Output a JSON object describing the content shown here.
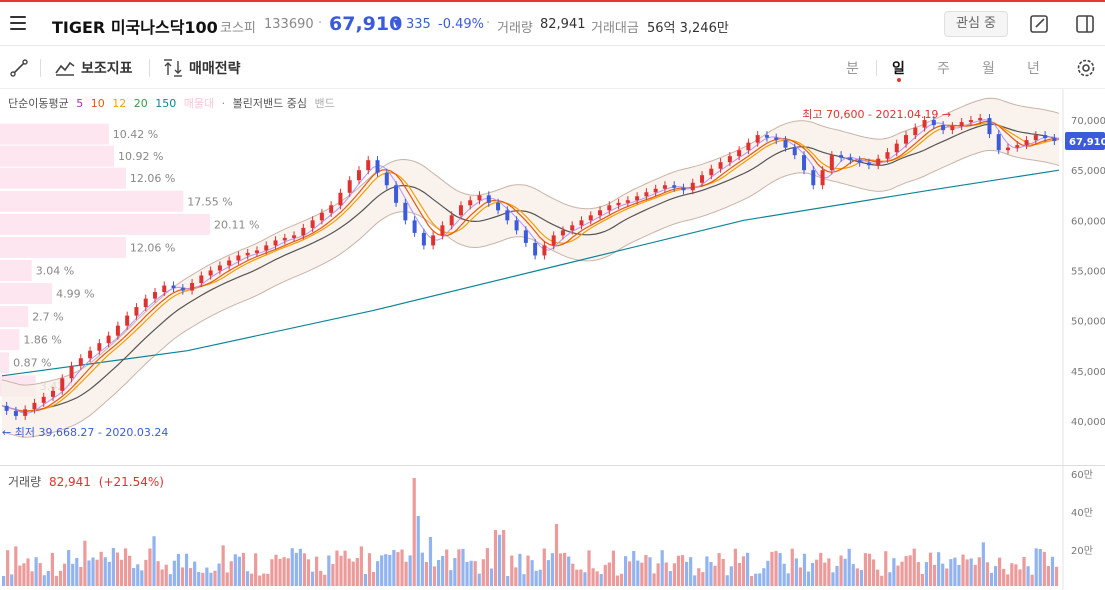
{
  "header": {
    "stock_name": "TIGER 미국나스닥100",
    "market": "코스피",
    "code": "133690",
    "price": "67,910",
    "change_arrow": "▼",
    "change": "335",
    "change_pct": "-0.49%",
    "volume_label": "거래량",
    "volume": "82,941",
    "amount_label": "거래대금",
    "amount": "56억 3,246만",
    "interest_button": "관심 중"
  },
  "toolbar": {
    "indicator_label": "보조지표",
    "strategy_label": "매매전략",
    "periods": [
      "분",
      "일",
      "주",
      "월",
      "년"
    ],
    "active_period": "일"
  },
  "legend": {
    "ma_label": "단순이동평균",
    "ma_periods": [
      {
        "text": "5",
        "color": "#9c36b5"
      },
      {
        "text": "10",
        "color": "#e8590c"
      },
      {
        "text": "12",
        "color": "#f59f00"
      },
      {
        "text": "20",
        "color": "#2f9e44"
      },
      {
        "text": "150",
        "color": "#0c8599"
      }
    ],
    "faded": "매물대",
    "bb_label": "볼린저밴드 중심",
    "band_label": "밴드"
  },
  "annotations": {
    "high": "최고 70,600 - 2021.04.19",
    "low": "최저 39,668.27 - 2020.03.24",
    "current_price_tag": "67,910"
  },
  "colors": {
    "accent_red": "#e03131",
    "accent_blue": "#3b5bdb",
    "volume_profile": "#fde2ef",
    "ma150": "#0c8599"
  },
  "volume_panel": {
    "label": "거래량",
    "value": "82,941",
    "change": "(+21.54%)"
  },
  "chart_data": {
    "type": "line",
    "y_axis_ticks": [
      "70,000",
      "65,000",
      "60,000",
      "55,000",
      "50,000",
      "45,000",
      "40,000"
    ],
    "ylim": [
      36000,
      72500
    ],
    "volume_axis_ticks": [
      "60만",
      "40만",
      "20만"
    ],
    "volume_profile": [
      {
        "label": "10.42 %",
        "price": 68600,
        "pct": 10.42
      },
      {
        "label": "10.92 %",
        "price": 66400,
        "pct": 10.92
      },
      {
        "label": "12.06 %",
        "price": 64200,
        "pct": 12.06
      },
      {
        "label": "17.55 %",
        "price": 61900,
        "pct": 17.55
      },
      {
        "label": "20.11 %",
        "price": 59600,
        "pct": 20.11
      },
      {
        "label": "12.06 %",
        "price": 57300,
        "pct": 12.06
      },
      {
        "label": "3.04 %",
        "price": 55000,
        "pct": 3.04
      },
      {
        "label": "4.99 %",
        "price": 52700,
        "pct": 4.99
      },
      {
        "label": "2.7 %",
        "price": 50400,
        "pct": 2.7
      },
      {
        "label": "1.86 %",
        "price": 48100,
        "pct": 1.86
      },
      {
        "label": "0.87 %",
        "price": 45800,
        "pct": 0.87
      },
      {
        "label": "3.42 %",
        "price": 43500,
        "pct": 3.42
      }
    ],
    "price_path": [
      [
        0,
        41500
      ],
      [
        2,
        40500
      ],
      [
        4,
        41800
      ],
      [
        6,
        43000
      ],
      [
        8,
        45500
      ],
      [
        10,
        47000
      ],
      [
        12,
        48500
      ],
      [
        14,
        50500
      ],
      [
        16,
        52200
      ],
      [
        18,
        53500
      ],
      [
        20,
        53000
      ],
      [
        22,
        54500
      ],
      [
        24,
        55500
      ],
      [
        26,
        56500
      ],
      [
        28,
        57000
      ],
      [
        30,
        58000
      ],
      [
        32,
        58500
      ],
      [
        34,
        60000
      ],
      [
        36,
        61500
      ],
      [
        38,
        64000
      ],
      [
        40,
        66000
      ],
      [
        42,
        63500
      ],
      [
        44,
        60000
      ],
      [
        46,
        57500
      ],
      [
        48,
        59500
      ],
      [
        50,
        61500
      ],
      [
        52,
        62500
      ],
      [
        54,
        61000
      ],
      [
        56,
        59000
      ],
      [
        58,
        56500
      ],
      [
        60,
        58500
      ],
      [
        62,
        59500
      ],
      [
        64,
        60500
      ],
      [
        66,
        61500
      ],
      [
        68,
        62000
      ],
      [
        70,
        62800
      ],
      [
        72,
        63500
      ],
      [
        74,
        63000
      ],
      [
        76,
        64500
      ],
      [
        78,
        65800
      ],
      [
        80,
        67000
      ],
      [
        82,
        68500
      ],
      [
        84,
        68000
      ],
      [
        86,
        66500
      ],
      [
        88,
        63500
      ],
      [
        90,
        66500
      ],
      [
        92,
        66000
      ],
      [
        94,
        65500
      ],
      [
        96,
        66800
      ],
      [
        98,
        68500
      ],
      [
        100,
        70000
      ],
      [
        102,
        69000
      ],
      [
        104,
        69800
      ],
      [
        106,
        70200
      ],
      [
        108,
        67000
      ],
      [
        110,
        67500
      ],
      [
        112,
        68500
      ],
      [
        114,
        67910
      ]
    ],
    "ma150_path": [
      [
        0,
        44500
      ],
      [
        20,
        47000
      ],
      [
        40,
        51000
      ],
      [
        60,
        55500
      ],
      [
        80,
        60000
      ],
      [
        100,
        63000
      ],
      [
        114,
        65000
      ]
    ],
    "high_point": [
      104,
      70600
    ],
    "low_point": [
      2,
      39668.27
    ]
  }
}
